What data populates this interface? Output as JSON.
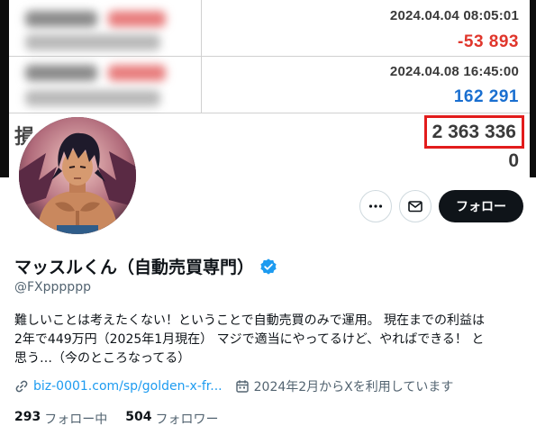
{
  "banner": {
    "trades": [
      {
        "timestamp": "2024.04.04 08:05:01",
        "amount": "-53 893",
        "sign": "negative"
      },
      {
        "timestamp": "2024.04.08 16:45:00",
        "amount": "162 291",
        "sign": "positive"
      }
    ],
    "total_label": "損",
    "total_value": "2 363 336",
    "zero_value": "0",
    "colors": {
      "negative": "#e0362c",
      "positive": "#1a6fd0",
      "highlight_border": "#e21c1c"
    }
  },
  "profile": {
    "display_name": "マッスルくん（自動売買専門）",
    "verified": true,
    "handle": "@FXpppppp",
    "bio_lines": [
      "難しいことは考えたくない！ということで自動売買のみで運用。 現在までの利益は",
      "2年で449万円（2025年1月現在） マジで適当にやってるけど、やればできる！ と",
      "思う…（今のところなってる）"
    ],
    "link_text": "biz-0001.com/sp/golden-x-fr...",
    "joined": "2024年2月からXを利用しています",
    "following_count": "293",
    "following_label": "フォロー中",
    "followers_count": "504",
    "followers_label": "フォロワー"
  },
  "actions": {
    "more_icon": "more-icon",
    "message_icon": "mail-icon",
    "follow_label": "フォロー"
  },
  "colors": {
    "accent": "#1d9bf0",
    "text": "#0f1419",
    "muted": "#536471",
    "button": "#0f1419"
  }
}
